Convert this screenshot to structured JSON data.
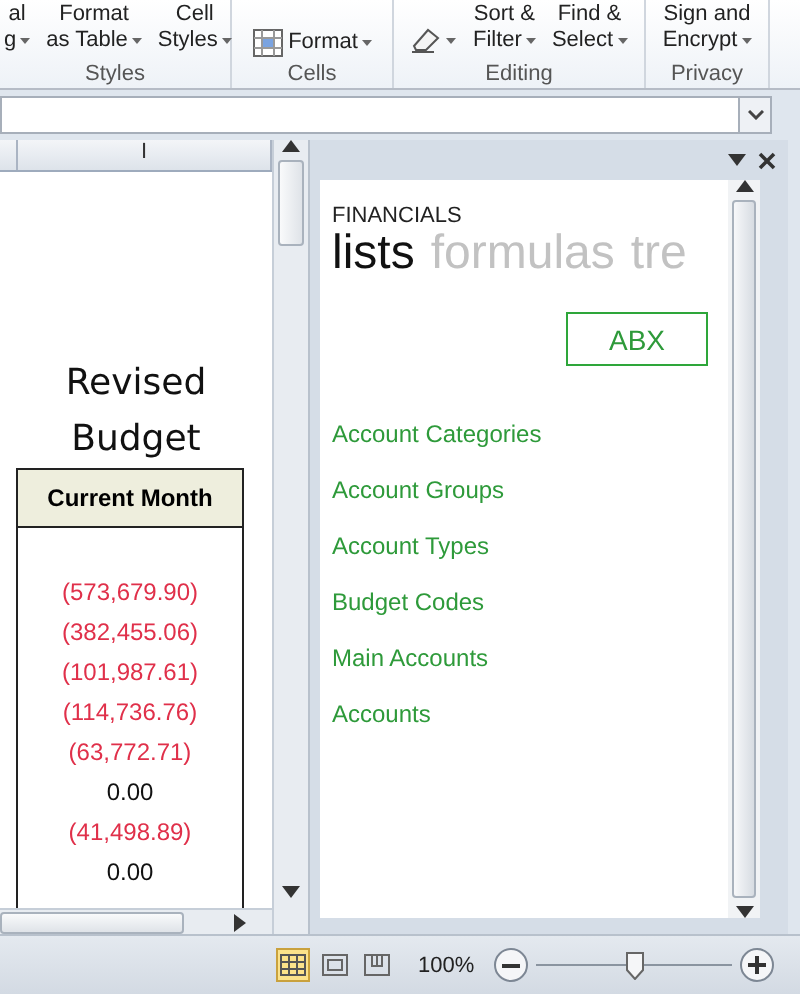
{
  "ribbon": {
    "groups": [
      {
        "label": "Styles",
        "buttons": [
          {
            "lines": [
              "al",
              "g"
            ],
            "kind": "text"
          },
          {
            "lines": [
              "Format",
              "as Table"
            ],
            "kind": "text"
          },
          {
            "lines": [
              "Cell",
              "Styles"
            ],
            "kind": "text"
          }
        ]
      },
      {
        "label": "Cells",
        "buttons": [
          {
            "lines": [
              "Format"
            ],
            "kind": "icon-text"
          }
        ]
      },
      {
        "label": "Editing",
        "buttons": [
          {
            "kind": "eraser"
          },
          {
            "lines": [
              "Sort &",
              "Filter"
            ],
            "kind": "text"
          },
          {
            "lines": [
              "Find &",
              "Select"
            ],
            "kind": "text"
          }
        ]
      },
      {
        "label": "Privacy",
        "buttons": [
          {
            "lines": [
              "Sign and",
              "Encrypt"
            ],
            "kind": "text"
          }
        ]
      }
    ]
  },
  "sheet": {
    "column": "I",
    "title_lines": [
      "Revised",
      "Budget"
    ],
    "header": "Current Month",
    "values": [
      {
        "text": "(573,679.90)",
        "negative": true
      },
      {
        "text": "(382,455.06)",
        "negative": true
      },
      {
        "text": "(101,987.61)",
        "negative": true
      },
      {
        "text": "(114,736.76)",
        "negative": true
      },
      {
        "text": "(63,772.71)",
        "negative": true
      },
      {
        "text": "0.00",
        "negative": false
      },
      {
        "text": "(41,498.89)",
        "negative": true
      },
      {
        "text": "0.00",
        "negative": false
      }
    ]
  },
  "task_pane": {
    "section": "FINANCIALS",
    "tabs": [
      {
        "label": "lists",
        "selected": true
      },
      {
        "label": "formulas",
        "selected": false
      },
      {
        "label": "tre",
        "selected": false
      }
    ],
    "button": "ABX",
    "links": [
      "Account Categories",
      "Account Groups",
      "Account Types",
      "Budget Codes",
      "Main Accounts",
      "Accounts"
    ]
  },
  "status_bar": {
    "views": [
      {
        "kind": "normal",
        "selected": true
      },
      {
        "kind": "layout",
        "selected": false
      },
      {
        "kind": "break",
        "selected": false
      }
    ],
    "zoom": "100%",
    "level": 0.5
  }
}
